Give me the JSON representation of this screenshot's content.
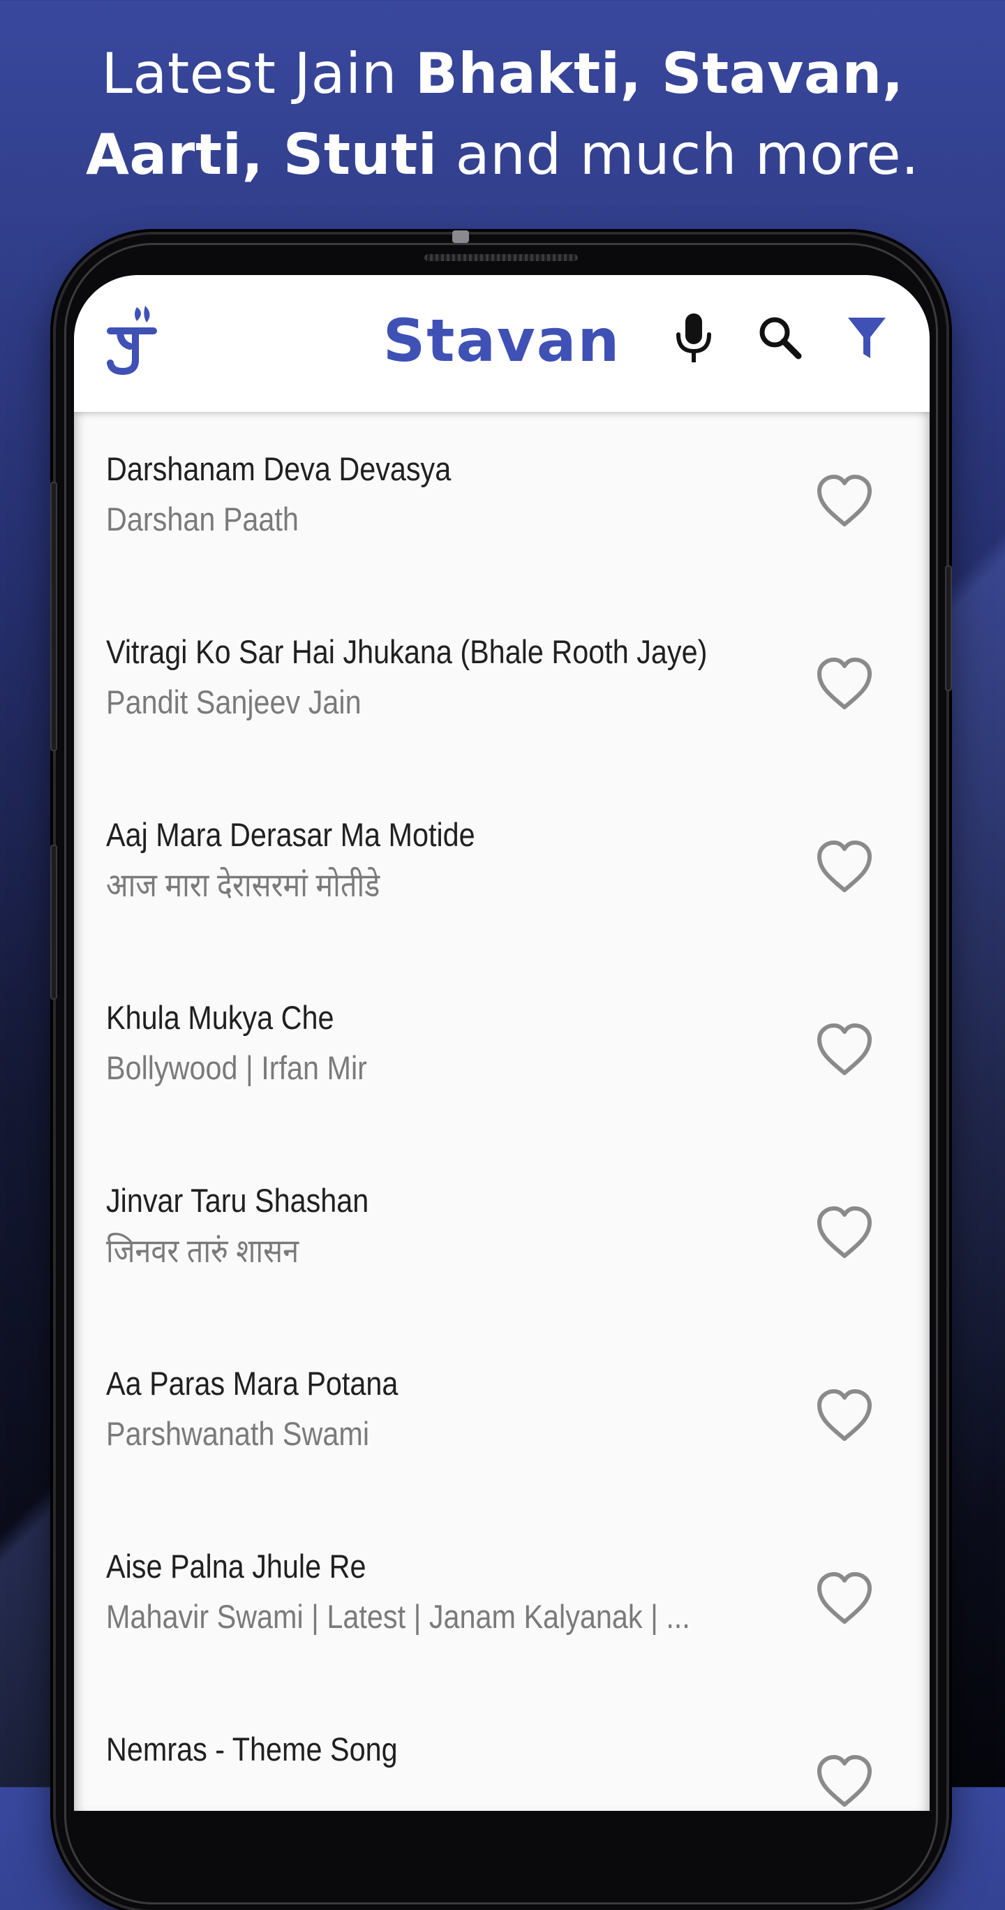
{
  "promo": {
    "line1_regular": "Latest Jain ",
    "line1_bold": "Bhakti, Stavan,",
    "line2_bold": "Aarti, Stuti",
    "line2_regular": " and much more."
  },
  "appbar": {
    "title": "Stavan",
    "logo_icon": "jain-om-logo-icon",
    "mic_icon": "microphone-icon",
    "search_icon": "search-icon",
    "filter_icon": "filter-icon"
  },
  "colors": {
    "accent": "#3f51b5",
    "title_text": "#202020",
    "subtitle_text": "#7a7a7a",
    "heart_outline": "#8a8a8a",
    "background_top": "#39489e",
    "background_bottom": "#05060c"
  },
  "songs": [
    {
      "title": "Darshanam Deva Devasya",
      "subtitle": "Darshan Paath",
      "favorite_icon": "heart-outline-icon"
    },
    {
      "title": "Vitragi Ko Sar Hai Jhukana (Bhale Rooth Jaye)",
      "subtitle": "Pandit Sanjeev Jain",
      "favorite_icon": "heart-outline-icon"
    },
    {
      "title": "Aaj Mara Derasar Ma Motide",
      "subtitle": "आज मारा देरासरमां मोतीडे",
      "favorite_icon": "heart-outline-icon"
    },
    {
      "title": "Khula Mukya Che",
      "subtitle": "Bollywood | Irfan Mir",
      "favorite_icon": "heart-outline-icon"
    },
    {
      "title": "Jinvar Taru Shashan",
      "subtitle": "जिनवर तारुं शासन",
      "favorite_icon": "heart-outline-icon"
    },
    {
      "title": "Aa Paras Mara Potana",
      "subtitle": "Parshwanath Swami",
      "favorite_icon": "heart-outline-icon"
    },
    {
      "title": "Aise Palna Jhule Re",
      "subtitle": "Mahavir Swami | Latest | Janam Kalyanak | ...",
      "favorite_icon": "heart-outline-icon"
    },
    {
      "title": "Nemras - Theme Song",
      "subtitle": "",
      "favorite_icon": "heart-outline-icon"
    }
  ]
}
